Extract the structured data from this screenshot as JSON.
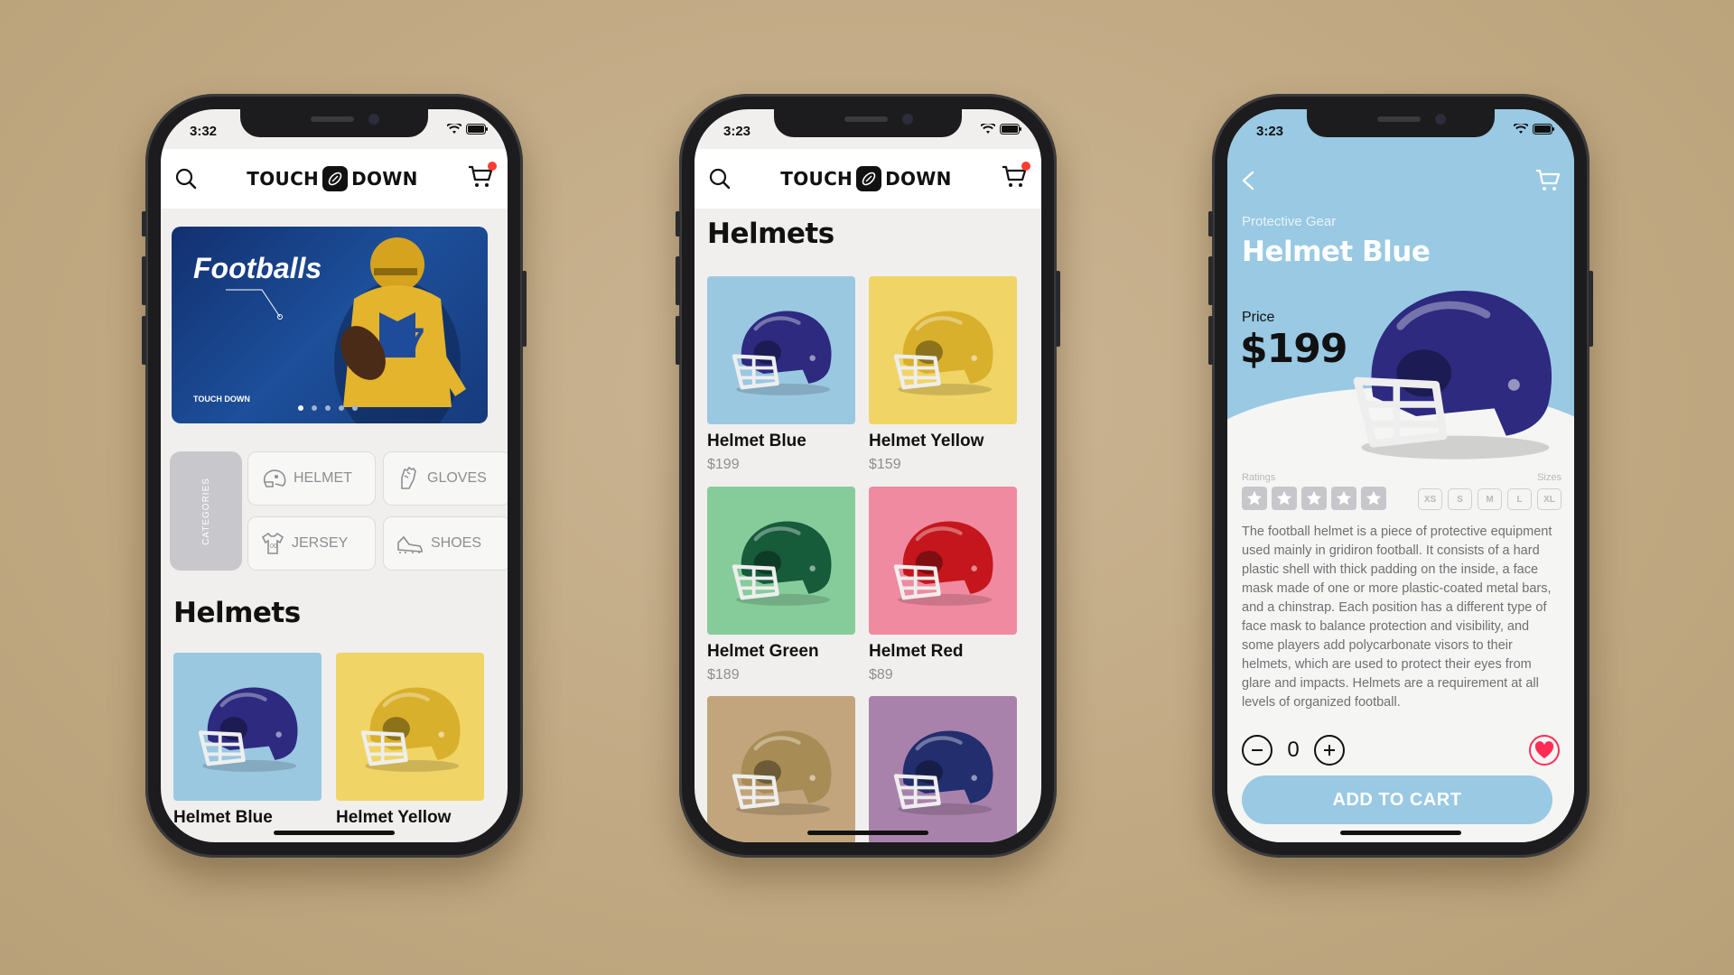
{
  "colors": {
    "accent_blue": "#99c9e3",
    "cart_badge": "#ff3b30",
    "favorite": "#ff2d55",
    "background": "#c4ad86"
  },
  "brand": {
    "left": "TOUCH",
    "right": "DOWN"
  },
  "screen1": {
    "time": "3:32",
    "banner": {
      "title": "Footballs",
      "brand_small": "TOUCH DOWN",
      "slides": 5,
      "active_slide": 1
    },
    "categories_label": "CATEGORIES",
    "categories": [
      {
        "label": "HELMET",
        "icon": "helmet-icon"
      },
      {
        "label": "GLOVES",
        "icon": "glove-icon"
      },
      {
        "label": "JERSEY",
        "icon": "jersey-icon"
      },
      {
        "label": "SHOES",
        "icon": "shoe-icon"
      }
    ],
    "section_title": "Helmets",
    "products": [
      {
        "name": "Helmet Blue",
        "color": "#9ac8e1",
        "helmet": "#2d2a80"
      },
      {
        "name": "Helmet Yellow",
        "color": "#f0d466",
        "helmet": "#d9b02c"
      }
    ]
  },
  "screen2": {
    "time": "3:23",
    "section_title": "Helmets",
    "products": [
      {
        "name": "Helmet Blue",
        "price": "$199",
        "color": "#9ac8e1",
        "helmet": "#2d2a80"
      },
      {
        "name": "Helmet Yellow",
        "price": "$159",
        "color": "#f0d466",
        "helmet": "#d9b02c"
      },
      {
        "name": "Helmet Green",
        "price": "$189",
        "color": "#86cc9a",
        "helmet": "#165b3a"
      },
      {
        "name": "Helmet Red",
        "price": "$89",
        "color": "#f08aa0",
        "helmet": "#c4161c"
      },
      {
        "color": "#c2a57c",
        "helmet": "#a88c55"
      },
      {
        "color": "#a982ab",
        "helmet": "#222e6e"
      }
    ]
  },
  "screen3": {
    "time": "3:23",
    "category": "Protective Gear",
    "title": "Helmet Blue",
    "price_label": "Price",
    "price": "$199",
    "ratings_label": "Ratings",
    "sizes_label": "Sizes",
    "rating": 0,
    "sizes": [
      "XS",
      "S",
      "M",
      "L",
      "XL"
    ],
    "description": "The football helmet is a piece of protective equipment used mainly in gridiron football. It consists of a hard plastic shell with thick padding on the inside, a face mask made of one or more plastic-coated metal bars, and a chinstrap. Each position has a different type of face mask to balance protection and visibility, and some players add polycarbonate visors to their helmets, which are used to protect their eyes from glare and impacts. Helmets are a requirement at all levels of organized football.",
    "quantity": "0",
    "add_to_cart": "ADD TO CART"
  }
}
